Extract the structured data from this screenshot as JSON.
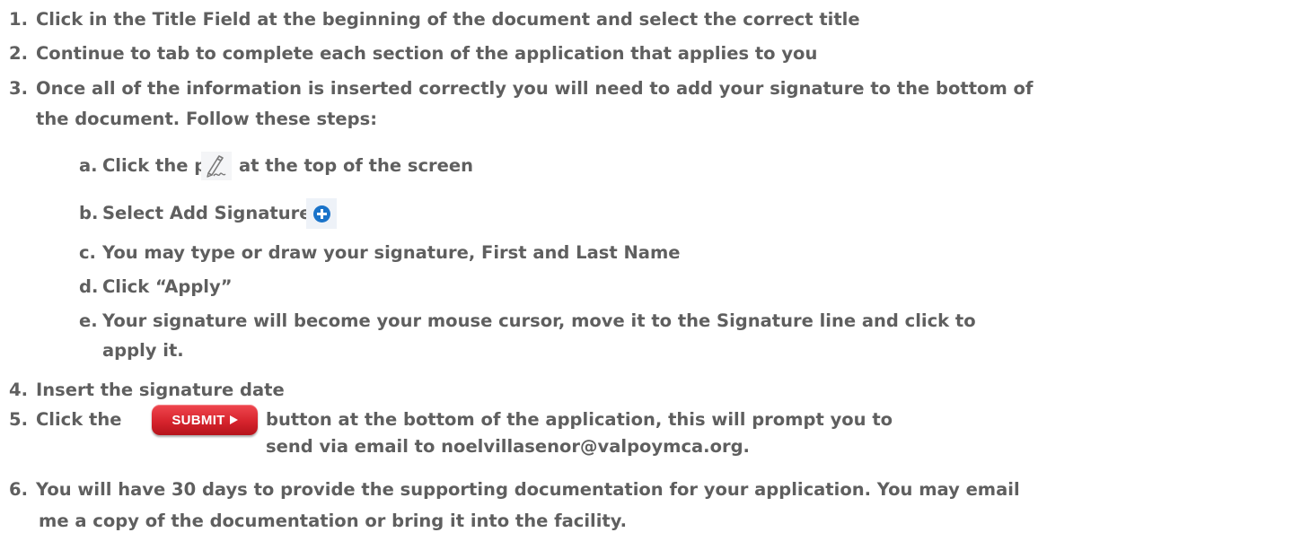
{
  "steps": [
    {
      "num": "1.",
      "lines": [
        "Click in the Title Field at the beginning of the document and select the correct title"
      ]
    },
    {
      "num": "2.",
      "lines": [
        "Continue to tab to complete each section of the application that applies to you"
      ]
    },
    {
      "num": "3.",
      "lines": [
        "Once all of the information is inserted correctly you will need to add your signature to the bottom of",
        "the document. Follow these steps:"
      ]
    },
    {
      "num": "4.",
      "lines": [
        "Insert the signature date"
      ]
    },
    {
      "num": "5.",
      "before": "Click the",
      "after": "button at the bottom of the application, this will prompt you to",
      "line2": "send via   email to noelvillasenor@valpoymca.org."
    },
    {
      "num": "6.",
      "lines": [
        "You will have 30 days to provide the supporting documentation for your application. You may email",
        "me a copy of the documentation or bring it into the facility."
      ]
    }
  ],
  "substeps": [
    {
      "letter": "a.",
      "before": "Click the pen",
      "after": "at the top of the screen",
      "icon": "pen-signature-icon"
    },
    {
      "letter": "b.",
      "text": "Select Add Signature",
      "icon": "plus-circle-icon"
    },
    {
      "letter": "c.",
      "text": "You may type or draw your signature, First and Last Name"
    },
    {
      "letter": "d.",
      "text": "Click “Apply”"
    },
    {
      "letter": "e.",
      "lines": [
        "Your signature will become your mouse cursor, move it to the Signature line and click to",
        "apply it."
      ]
    }
  ],
  "submit_button": {
    "label": "SUBMIT",
    "icon": "play-triangle-icon",
    "color": "#d7242d"
  },
  "colors": {
    "text": "#5f5f5f",
    "plus_icon": "#1a73c9"
  }
}
